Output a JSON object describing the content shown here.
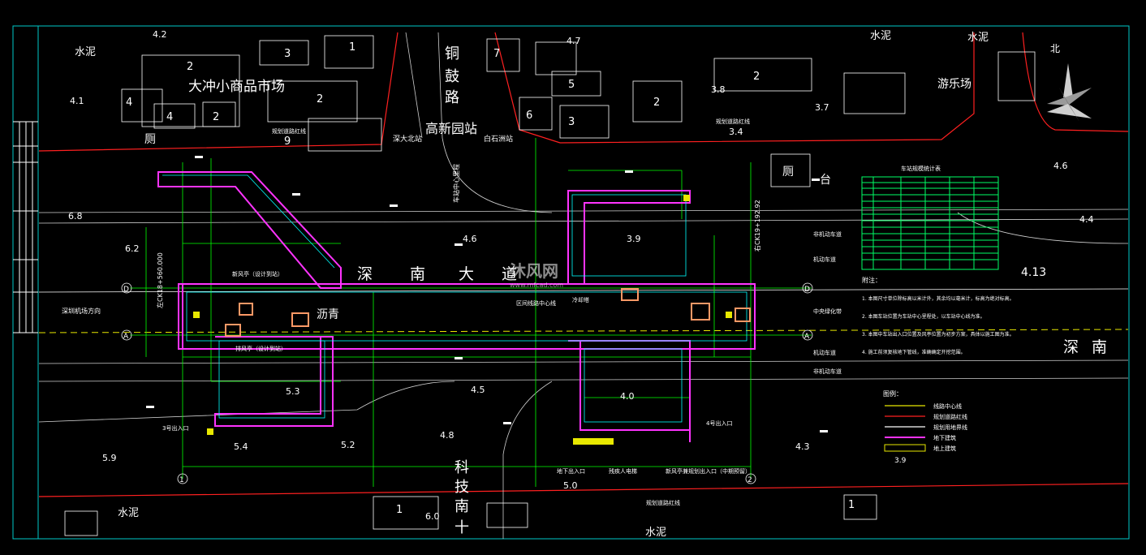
{
  "drawing": {
    "station_name": "高新园站",
    "road_main": [
      "深",
      "南",
      "大",
      "道"
    ],
    "road_main_2": [
      "深",
      "南"
    ],
    "road_main_cut": [
      "深",
      "南",
      "大",
      "道",
      "沥",
      "青"
    ],
    "road_north": [
      "铜",
      "鼓",
      "路"
    ],
    "road_south": [
      "科",
      "技",
      "南",
      "十"
    ],
    "market": "大冲小商品市场",
    "playground": "游乐场",
    "toilet_a": "厕",
    "toilet_b": "厕",
    "platform_word": "台",
    "surface_cement": "水泥",
    "surface_asphalt": "沥青",
    "north_mark": "北",
    "stop_bus_1": "深大北站",
    "stop_bus_2": "白石洲站",
    "dir_airport": "深圳机场方向",
    "lane_nonmotor": "非机动车道",
    "lane_motor": "机动车道",
    "lane_median": "中央绿化带",
    "exit_3": "3号出入口",
    "exit_4": "4号出入口",
    "vent_new": "新风亭（设计到站）",
    "vent_row": "排风亭（设计到站）",
    "cooling_tower": "冷却塔",
    "label_boundary": "规划道路红线",
    "label_exit_bottom": "地下出入口",
    "label_stairs": "残疾人电梯",
    "label_future": "新风亭兼规划出入口（中期预留）",
    "label_centerline": "区间线路中心线",
    "grid_A": "A",
    "grid_D": "D",
    "grid_1": "1",
    "grid_2": "2",
    "watermark": "沐风网",
    "watermark_url": "www.mfcad.com",
    "notes_title": "附注：",
    "notes": [
      "1. 本图尺寸单位除标高以米计外，其余均以毫米计，标高为绝对标高。",
      "2. 本图车站位置为车站中心里程处，以车站中心线为准。",
      "3. 本图中车站出入口位置及风亭位置为初步方案，具体以施工图为准。",
      "4. 施工前须复核地下管线，准确确定开挖范围。"
    ],
    "legend_title": "图例：",
    "legend": [
      {
        "label": "线路中心线",
        "color": "#e8e800"
      },
      {
        "label": "规划道路红线",
        "color": "#ff2020"
      },
      {
        "label": "规划用地界线",
        "color": "#ffffff"
      },
      {
        "label": "地下建筑",
        "color": "#ff33ff"
      },
      {
        "label": "地上建筑",
        "color": "#e8e800"
      }
    ],
    "legend_val": "3.9",
    "table_title": "车站规模统计表",
    "elevations": [
      "4.2",
      "4.1",
      "3.8",
      "3.4",
      "4.6",
      "4.4",
      "3.7",
      "4.13",
      "6.8",
      "6.2",
      "5.9",
      "4.3",
      "4.5",
      "4.8",
      "5.0",
      "6.0",
      "5.2",
      "5.3",
      "5.4",
      "4.0",
      "3.9",
      "4.7",
      "4.6"
    ],
    "building_numbers": [
      "2",
      "3",
      "4",
      "2",
      "2",
      "1",
      "1",
      "7",
      "2",
      "5",
      "6",
      "3",
      "9",
      "2",
      "1",
      "4"
    ],
    "km_marks": [
      "左CK18+560.000",
      "右CK19+192.92",
      "车站中心里程"
    ],
    "colors": {
      "bg": "#000000",
      "frame": "#00c8c8",
      "building": "#ffffff",
      "station": "#ff33ff",
      "grid": "#00ff00",
      "road_edge": "#ff2020",
      "yellow": "#e8e800",
      "cyan": "#00ffff",
      "text_white": "#ffffff"
    }
  }
}
